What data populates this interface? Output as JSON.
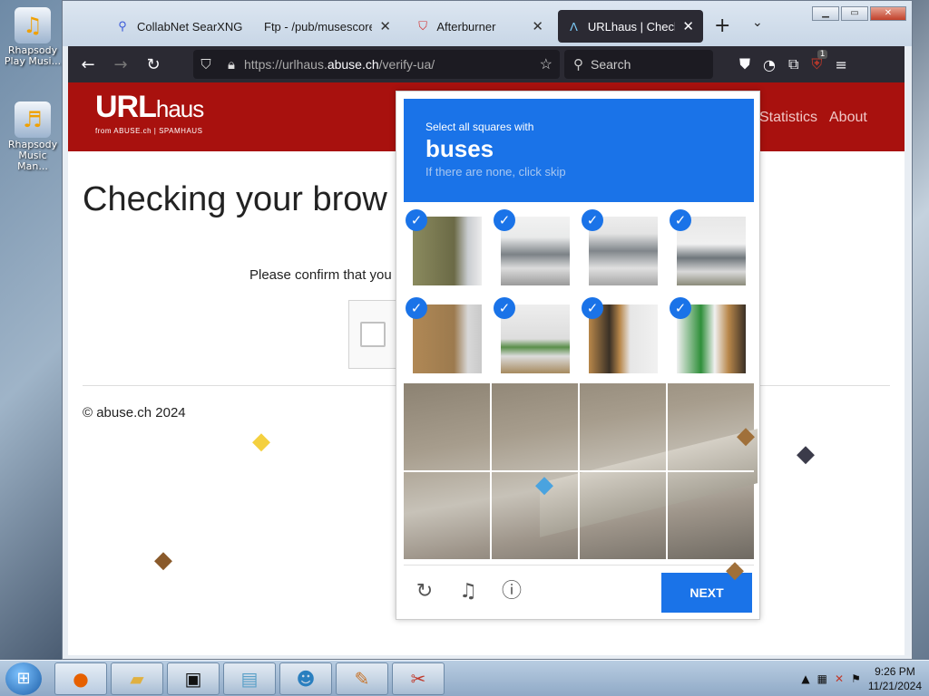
{
  "desktop": {
    "icons": [
      {
        "label": "Rhapsody Play Musi..."
      },
      {
        "label": "Rhapsody Music Man..."
      }
    ]
  },
  "browser": {
    "tabs": [
      {
        "label": "CollabNet SearXNG",
        "icon": "search-icon"
      },
      {
        "label": "Ftp - /pub/musescore/r",
        "icon": "none"
      },
      {
        "label": "Afterburner",
        "icon": "shield-icon"
      },
      {
        "label": "URLhaus | Checking",
        "icon": "urlhaus-icon",
        "active": true
      }
    ],
    "url_prefix": "https://urlhaus.",
    "url_host": "abuse.ch",
    "url_path": "/verify-ua/",
    "search_placeholder": "Search",
    "extension_badge": "1"
  },
  "site": {
    "logo_main": "URL",
    "logo_haus": "haus",
    "logo_sub": "from ABUSE.ch | SPAMHAUS",
    "nav": [
      "Statistics",
      "About"
    ],
    "title": "Checking your brow",
    "confirm_text": "Please confirm that you",
    "footer": "© abuse.ch 2024"
  },
  "captcha": {
    "instruction_line1": "Select all squares with",
    "target": "buses",
    "instruction_line3": "If there are none, click skip",
    "tiles_selected": [
      true,
      true,
      true,
      true,
      true,
      true,
      true,
      true
    ],
    "next_label": "NEXT",
    "accent": "#1a73e8"
  },
  "taskbar": {
    "time": "9:26 PM",
    "date": "11/21/2024"
  }
}
